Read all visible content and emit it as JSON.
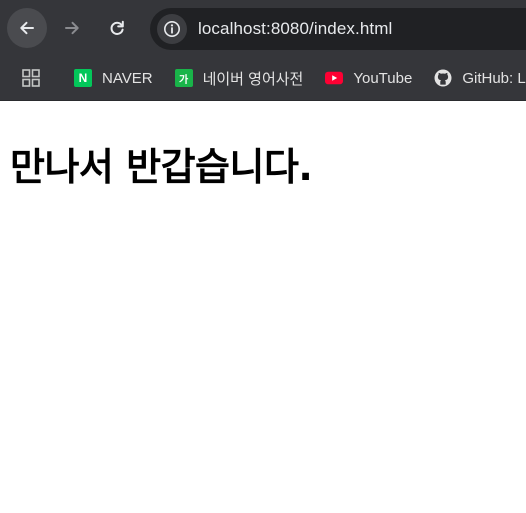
{
  "browser": {
    "url": "localhost:8080/index.html"
  },
  "toolbar": {
    "icons": [
      "back-arrow-icon",
      "forward-arrow-icon",
      "reload-icon",
      "info-icon"
    ]
  },
  "bookmarks": {
    "apps_icon": "apps-grid-icon",
    "items": [
      {
        "label": "NAVER",
        "favicon_text": "N",
        "icon": "naver-icon",
        "color": "#03c75a"
      },
      {
        "label": "네이버 영어사전",
        "favicon_text": "가",
        "icon": "naver-dictionary-icon",
        "color": "#19b449"
      },
      {
        "label": "YouTube",
        "icon": "youtube-icon",
        "color": "#ff0033"
      },
      {
        "label": "GitHub: L",
        "icon": "github-icon",
        "color": "#e3e3e3"
      }
    ]
  },
  "page": {
    "heading": "만나서 반갑습니다."
  },
  "colors": {
    "chrome_background": "#35363a",
    "omnibox_background": "#202124",
    "text_light": "#e3e3e3"
  }
}
